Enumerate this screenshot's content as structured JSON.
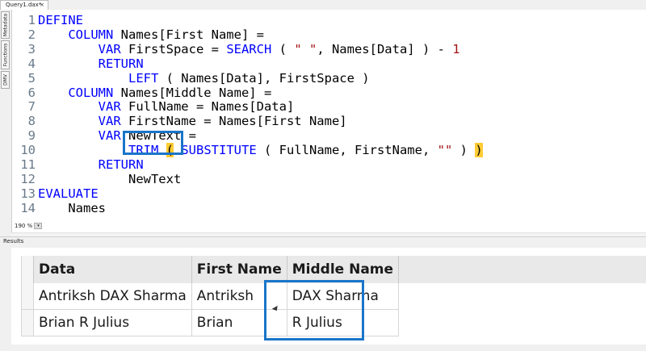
{
  "tab": {
    "title": "Query1.dax*",
    "close": "×"
  },
  "side_tabs": [
    "Metadata",
    "Functions",
    "DMV"
  ],
  "editor": {
    "lines": [
      {
        "n": "1",
        "html": "<span class=\"kw\">DEFINE</span>"
      },
      {
        "n": "2",
        "html": "    <span class=\"kw\">COLUMN</span> Names[First Name] ="
      },
      {
        "n": "3",
        "html": "        <span class=\"kw\">VAR</span> FirstSpace = <span class=\"kw\">SEARCH</span> ( <span class=\"str\">\" \"</span>, Names[Data] ) - <span class=\"num\">1</span>"
      },
      {
        "n": "4",
        "html": "        <span class=\"kw\">RETURN</span>"
      },
      {
        "n": "5",
        "html": "            <span class=\"kw\">LEFT</span> ( Names[Data], FirstSpace )"
      },
      {
        "n": "6",
        "html": "    <span class=\"kw\">COLUMN</span> Names[Middle Name] ="
      },
      {
        "n": "7",
        "html": "        <span class=\"kw\">VAR</span> FullName = Names[Data]"
      },
      {
        "n": "8",
        "html": "        <span class=\"kw\">VAR</span> FirstName = Names[First Name]"
      },
      {
        "n": "9",
        "html": "        <span class=\"kw\">VAR</span> NewText ="
      },
      {
        "n": "10",
        "html": "            <span class=\"kw\">TRIM</span> <span class=\"paren\">(</span> <span class=\"kw\">SUBSTITUTE</span> ( FullName, FirstName, <span class=\"str\">\"\"</span> ) <span class=\"paren\">)</span>"
      },
      {
        "n": "11",
        "html": "        <span class=\"kw\">RETURN</span>"
      },
      {
        "n": "12",
        "html": "            NewText"
      },
      {
        "n": "13",
        "html": "<span class=\"kw\">EVALUATE</span>"
      },
      {
        "n": "14",
        "html": "    Names"
      }
    ],
    "zoom": "190 %"
  },
  "results": {
    "label": "Results",
    "columns": [
      "Data",
      "First Name",
      "Middle Name"
    ],
    "rows": [
      [
        "Antriksh DAX Sharma",
        "Antriksh",
        "DAX Sharma"
      ],
      [
        "Brian R Julius",
        "Brian",
        "R Julius"
      ]
    ]
  },
  "colors": {
    "keyword": "#0000ff",
    "string": "#a31515",
    "highlight_box": "#1a75c9",
    "brace_match": "#ffcc33"
  }
}
